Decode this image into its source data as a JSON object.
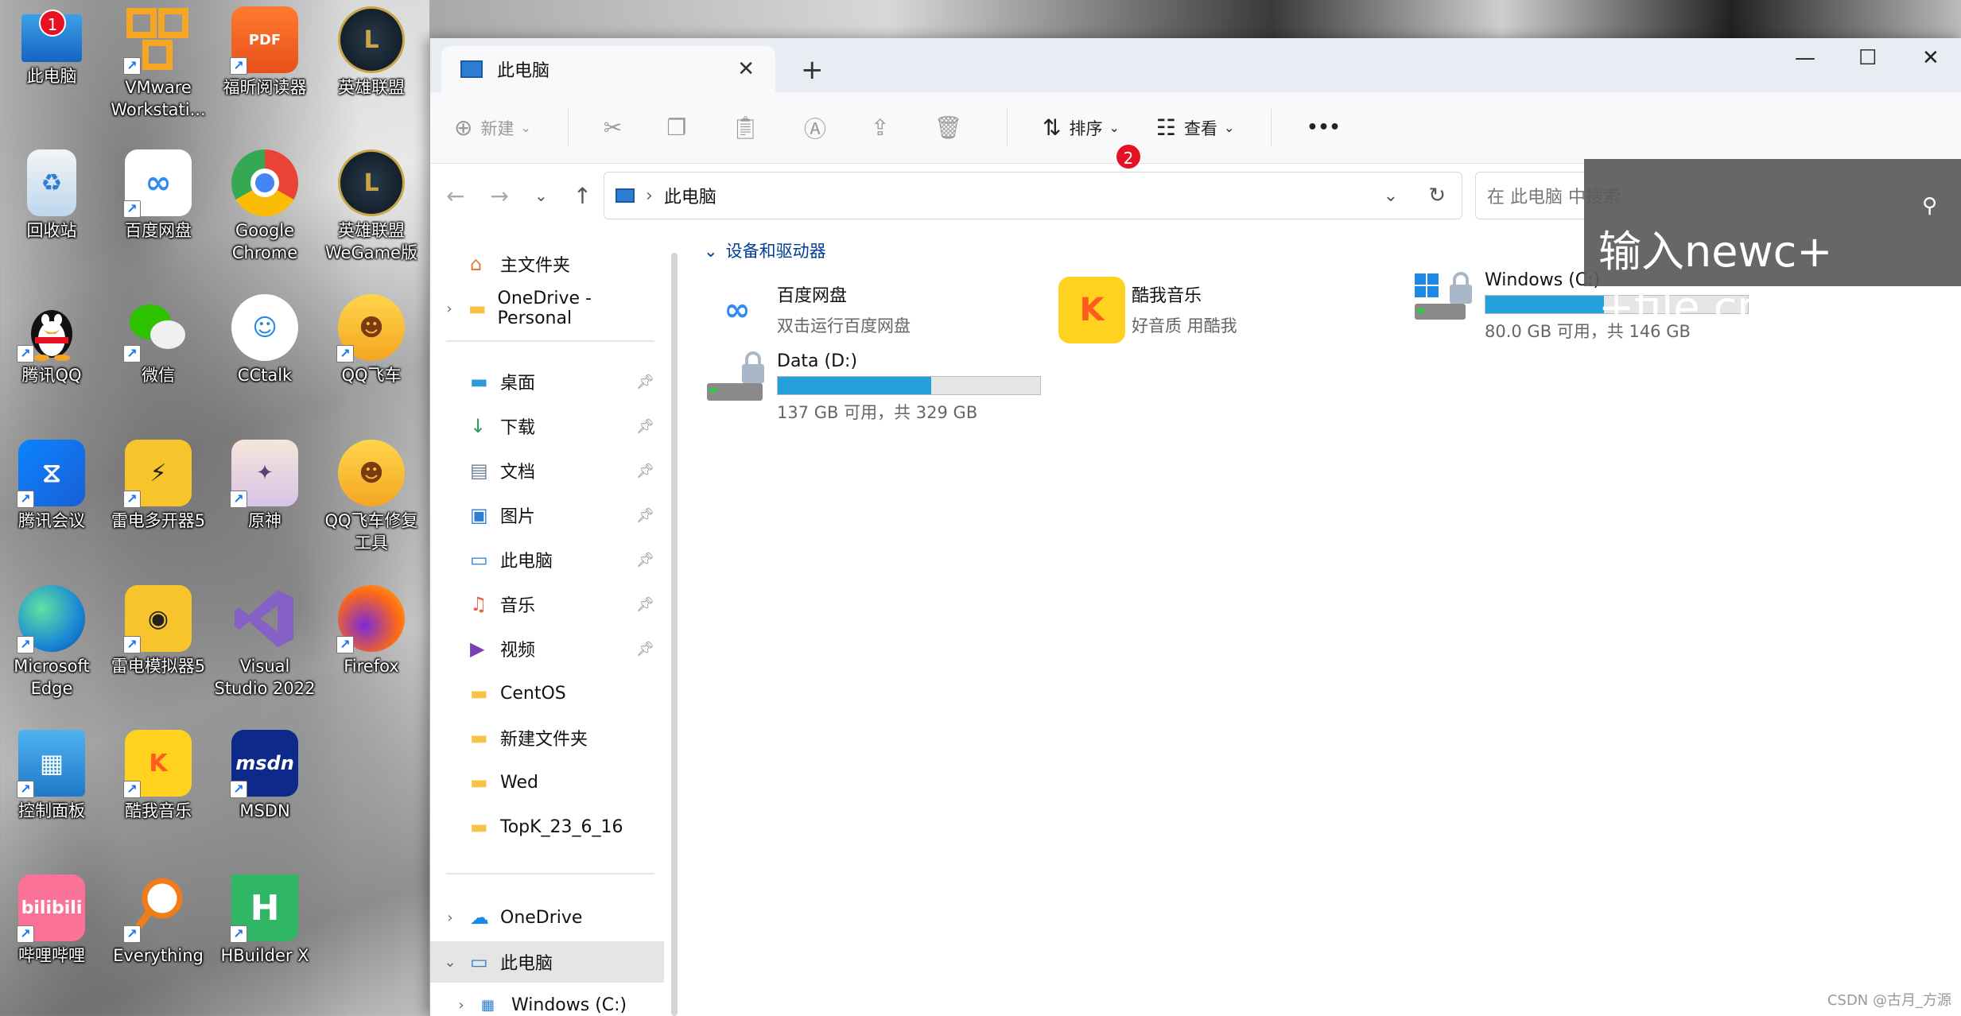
{
  "desktop": {
    "icons": [
      {
        "label": "此电脑",
        "badge": "1"
      },
      {
        "label": "VMware\nWorkstati..."
      },
      {
        "label": "福昕阅读器",
        "glyph": "PDF"
      },
      {
        "label": "英雄联盟"
      },
      {
        "label": "回收站"
      },
      {
        "label": "百度网盘"
      },
      {
        "label": "Google\nChrome"
      },
      {
        "label": "英雄联盟\nWeGame版"
      },
      {
        "label": "腾讯QQ"
      },
      {
        "label": "微信"
      },
      {
        "label": "CCtalk"
      },
      {
        "label": "QQ飞车"
      },
      {
        "label": "腾讯会议"
      },
      {
        "label": "雷电多开器5"
      },
      {
        "label": "原神"
      },
      {
        "label": "QQ飞车修复\n工具"
      },
      {
        "label": "Microsoft\nEdge"
      },
      {
        "label": "雷电模拟器5"
      },
      {
        "label": "Visual\nStudio 2022"
      },
      {
        "label": "Firefox"
      },
      {
        "label": "控制面板"
      },
      {
        "label": "酷我音乐"
      },
      {
        "label": "MSDN",
        "glyph": "msdn"
      },
      {
        "label": "哔哩哔哩",
        "glyph": "bilibili"
      },
      {
        "label": "Everything"
      },
      {
        "label": "HBuilder X",
        "glyph": "H"
      }
    ]
  },
  "window": {
    "tab_title": "此电脑",
    "toolbar": {
      "new_label": "新建",
      "sort_label": "排序",
      "view_label": "查看",
      "more_label": "•••"
    },
    "address": {
      "path": "此电脑"
    },
    "search": {
      "placeholder": "在 此电脑 中搜索",
      "badge": "2"
    },
    "overlay_text": "输入newc+\n+file.cpp",
    "sidebar": {
      "home": "主文件夹",
      "onedrive_personal": "OneDrive - Personal",
      "pinned": [
        {
          "label": "桌面",
          "icon": "desktop-folder-icon"
        },
        {
          "label": "下载",
          "icon": "download-icon"
        },
        {
          "label": "文档",
          "icon": "document-icon"
        },
        {
          "label": "图片",
          "icon": "picture-icon"
        },
        {
          "label": "此电脑",
          "icon": "computer-icon"
        },
        {
          "label": "音乐",
          "icon": "music-icon"
        },
        {
          "label": "视频",
          "icon": "video-icon"
        },
        {
          "label": "CentOS",
          "icon": "folder-icon"
        },
        {
          "label": "新建文件夹",
          "icon": "folder-icon"
        },
        {
          "label": "Wed",
          "icon": "folder-icon"
        },
        {
          "label": "TopK_23_6_16",
          "icon": "folder-icon"
        }
      ],
      "onedrive": "OneDrive",
      "this_pc": "此电脑",
      "windows_c": "Windows (C:)"
    },
    "content": {
      "group_title": "设备和驱动器",
      "items": [
        {
          "title": "百度网盘",
          "subtitle": "双击运行百度网盘"
        },
        {
          "title": "酷我音乐",
          "subtitle": "好音质 用酷我"
        },
        {
          "title": "Windows (C:)",
          "subtitle": "80.0 GB 可用，共 146 GB",
          "used_fraction": 0.452
        },
        {
          "title": "Data (D:)",
          "subtitle": "137 GB 可用，共 329 GB",
          "used_fraction": 0.584
        }
      ]
    }
  },
  "watermark": "CSDN @古月_方源",
  "colors": {
    "accent": "#26a0da",
    "badge": "#e81123",
    "link": "#003e92"
  }
}
